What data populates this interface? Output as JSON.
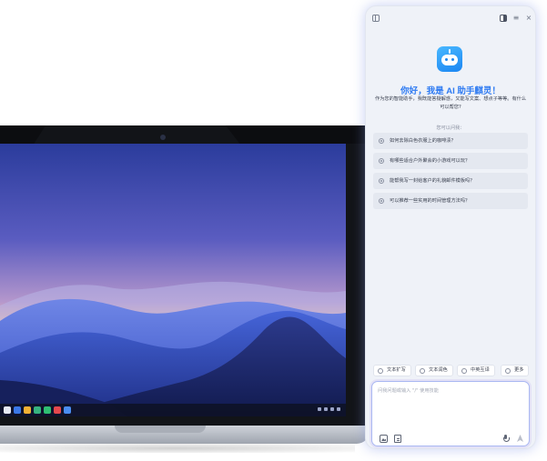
{
  "assistant": {
    "greeting": "你好，我是 AI 助手麒灵！",
    "intro": "作为您的智能助手，我既能答疑解惑，又能写文案、想点子等等。有什么可以帮您?",
    "suggest_label": "您可以问我：",
    "questions": [
      "如何去除白色衣服上的咖啡渍？",
      "有哪些适合户外聚会的小游戏可以玩？",
      "能帮我写一封给客户的礼貌邮件模板吗？",
      "可以推荐一些实用的时间管理方法吗？"
    ],
    "chips": [
      "文本扩写",
      "文本润色",
      "中英互译",
      "更多"
    ],
    "input_placeholder": "问我问题或输入 \"/\" 使用技能"
  },
  "colors": {
    "accent": "#2f7bf2",
    "panel_bg": "#eff2f8",
    "question_bg": "#e4e8f0",
    "input_border": "#a9b7f2"
  },
  "icons": {
    "titlebar": [
      "sidebar-toggle-icon",
      "layout-icon",
      "menu-icon",
      "close-icon"
    ],
    "input": [
      "image-icon",
      "file-icon",
      "microphone-icon",
      "send-icon"
    ]
  }
}
